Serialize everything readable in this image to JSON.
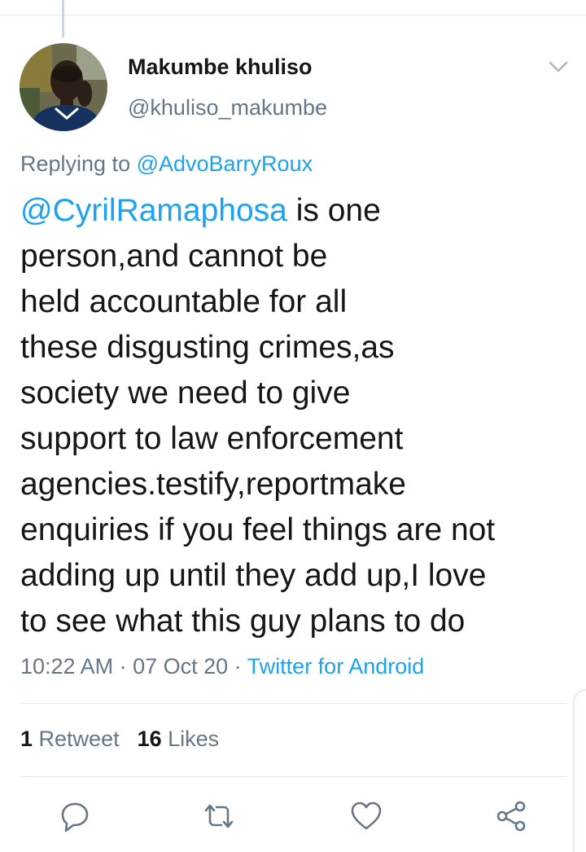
{
  "author": {
    "display_name": "Makumbe khuliso",
    "handle": "@khuliso_makumbe"
  },
  "reply": {
    "prefix": "Replying to ",
    "to": "@AdvoBarryRoux"
  },
  "tweet": {
    "mention": "@CyrilRamaphosa",
    "lines": [
      " is one",
      "person,and cannot be",
      "held accountable for all",
      "these disgusting crimes,as",
      "society we need to give",
      "support to law enforcement",
      "agencies.testify,reportmake",
      "enquiries if you feel things are not",
      "adding up until they add up,I love",
      "to see what this guy plans to do"
    ]
  },
  "meta": {
    "time": "10:22 AM",
    "separator": " · ",
    "date": "07 Oct 20",
    "source": "Twitter for Android"
  },
  "stats": {
    "retweets_count": "1",
    "retweets_label": " Retweet",
    "likes_count": "16",
    "likes_label": " Likes"
  },
  "actions": [
    "reply-icon",
    "retweet-icon",
    "like-icon",
    "share-icon"
  ],
  "colors": {
    "link": "#1da1f2",
    "secondary_text": "#657786",
    "primary_text": "#14171a",
    "divider": "#e1e8ed"
  }
}
